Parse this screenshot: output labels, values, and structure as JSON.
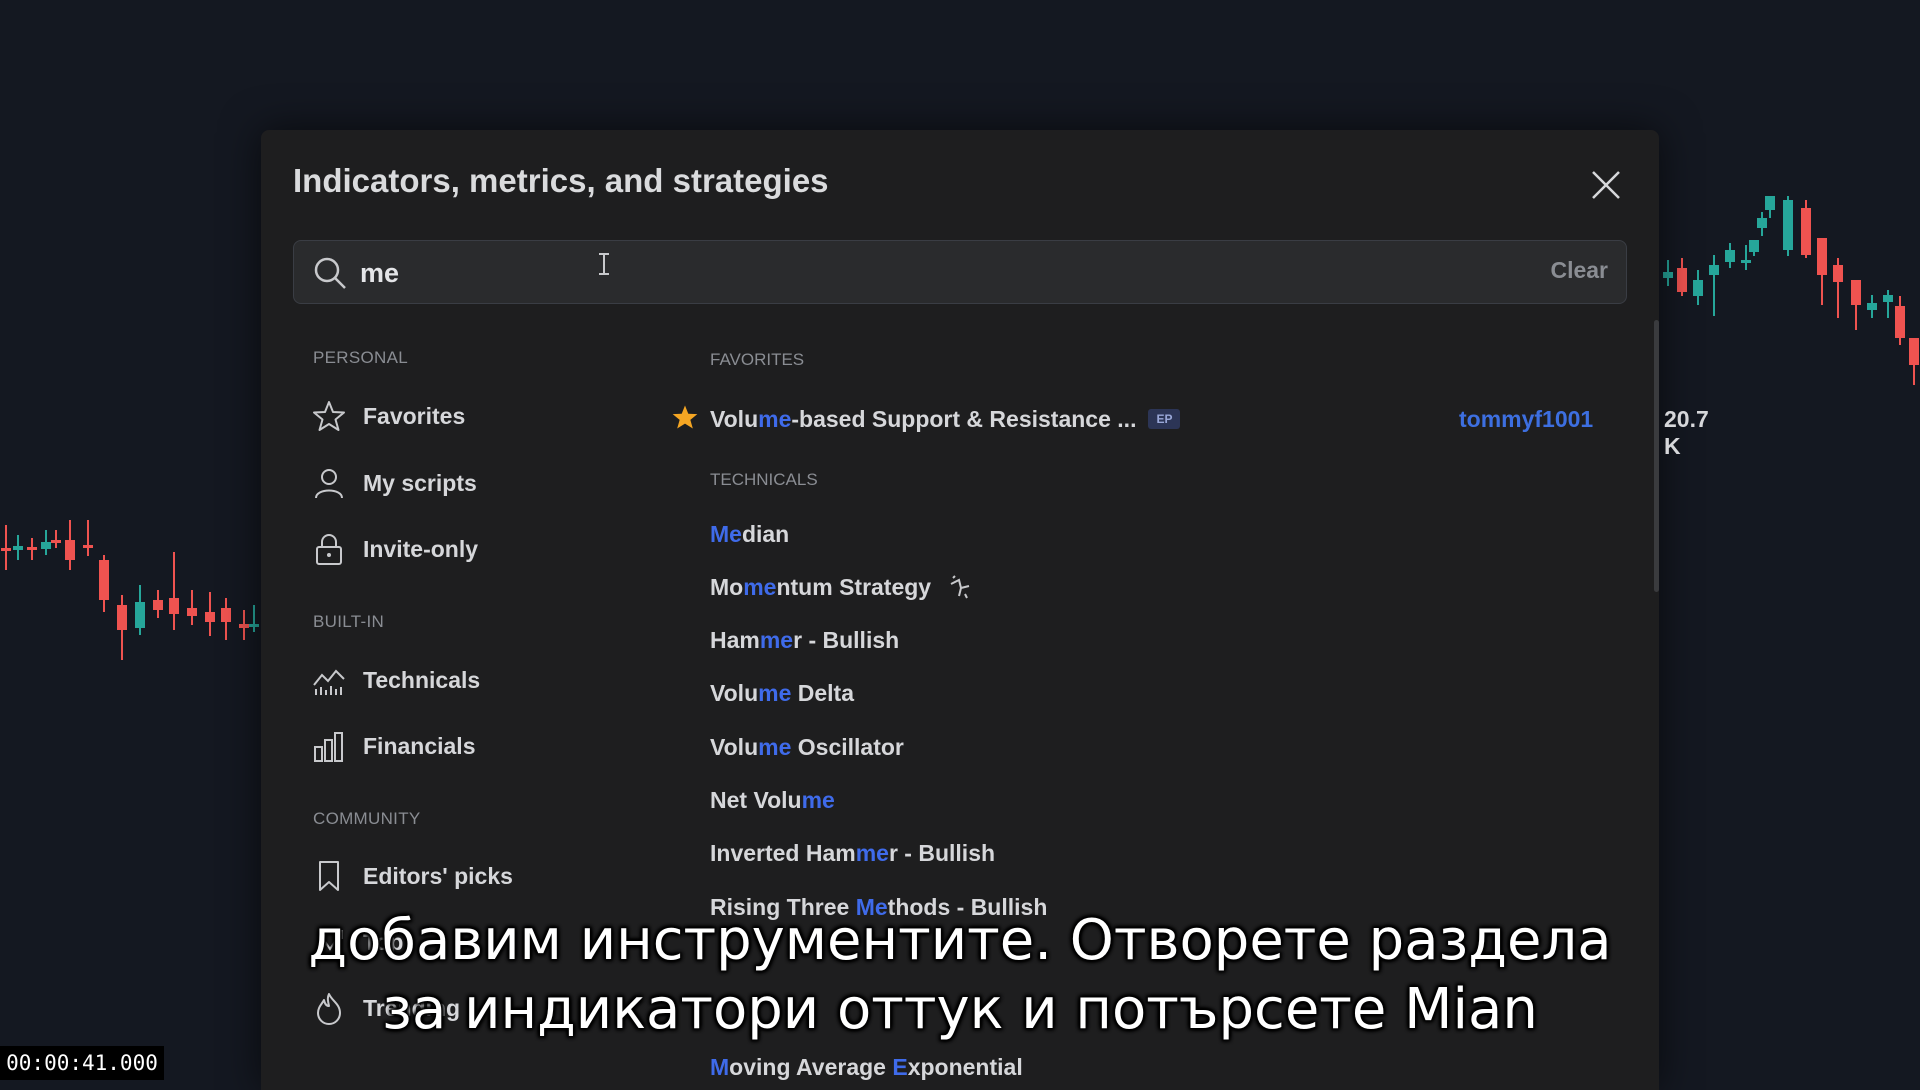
{
  "dialog": {
    "title": "Indicators, metrics, and strategies",
    "close_icon": "close-icon"
  },
  "search": {
    "value": "me",
    "placeholder": "",
    "clear_label": "Clear",
    "icon": "search-icon"
  },
  "sidebar": {
    "personal_label": "PERSONAL",
    "builtin_label": "BUILT-IN",
    "community_label": "COMMUNITY",
    "items": [
      {
        "label": "Favorites",
        "icon": "star-icon"
      },
      {
        "label": "My scripts",
        "icon": "user-icon"
      },
      {
        "label": "Invite-only",
        "icon": "lock-icon"
      },
      {
        "label": "Technicals",
        "icon": "technicals-chart-icon"
      },
      {
        "label": "Financials",
        "icon": "bar-chart-icon"
      },
      {
        "label": "Editors' picks",
        "icon": "bookmark-icon"
      },
      {
        "label": "Top",
        "icon": "top-chart-icon"
      },
      {
        "label": "Trending",
        "icon": "flame-icon"
      }
    ]
  },
  "results": {
    "favorites_label": "FAVORITES",
    "favorite": {
      "name_pre": "Volu",
      "name_hl": "me",
      "name_post": "-based Support & Resistance ...",
      "badge": "EP",
      "author": "tommyf1001",
      "likes": "20.7 K",
      "star_color": "#f5a623"
    },
    "technicals_label": "TECHNICALS",
    "technicals": [
      {
        "pre": "",
        "hl": "Me",
        "post": "dian"
      },
      {
        "pre": "Mo",
        "hl": "me",
        "post": "ntum Strategy"
      },
      {
        "pre": "Ham",
        "hl": "me",
        "post": "r - Bullish"
      },
      {
        "pre": "Volu",
        "hl": "me",
        "post": " Delta"
      },
      {
        "pre": "Volu",
        "hl": "me",
        "post": " Oscillator"
      },
      {
        "pre": "Net Volu",
        "hl": "me",
        "post": ""
      },
      {
        "pre": "Inverted Ham",
        "hl": "me",
        "post": "r - Bullish"
      },
      {
        "pre": "Rising Three ",
        "hl": "Me",
        "post": "thods - Bullish"
      },
      {
        "pre": "",
        "hl": "M",
        "post": "oving Average ",
        "hl2": "E",
        "post2": "xponential"
      }
    ]
  },
  "subtitles": {
    "line1": "добавим инструментите. Отворете раздела",
    "line2": "за индикатори оттук и потърсете Mian"
  },
  "timestamp": "00:00:41.000",
  "colors": {
    "highlight": "#3f6bea",
    "candle_up": "#26a69a",
    "candle_down": "#ef5350",
    "background": "#141821",
    "dialog": "#1e1e1f"
  }
}
